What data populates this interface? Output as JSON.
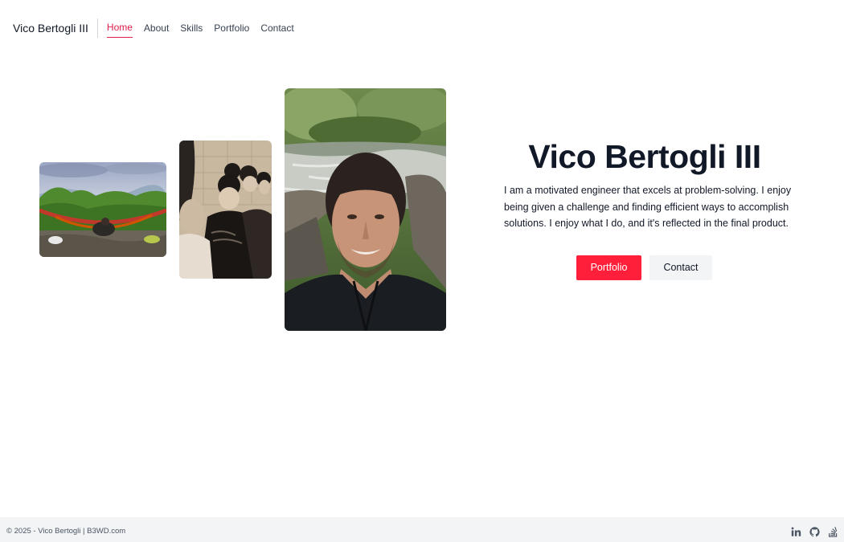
{
  "nav": {
    "brand": "Vico Bertogli III",
    "links": [
      "Home",
      "About",
      "Skills",
      "Portfolio",
      "Contact"
    ],
    "active": "Home"
  },
  "hero": {
    "title": "Vico Bertogli III",
    "description": "I am a motivated engineer that excels at problem-solving. I enjoy being given a challenge and finding efficient ways to accomplish solutions. I enjoy what I do, and it's reflected in the final product.",
    "primary_button": "Portfolio",
    "secondary_button": "Contact"
  },
  "photos": [
    {
      "subject": "hammock-landscape-photo"
    },
    {
      "subject": "childhood-group-photo"
    },
    {
      "subject": "portrait-by-river-photo"
    }
  ],
  "footer": {
    "copyright": "© 2025 - Vico Bertogli | B3WD.com",
    "icons": [
      "linkedin-icon",
      "github-icon",
      "stackoverflow-icon"
    ]
  },
  "colors": {
    "accent": "#ff1f3a",
    "active_link": "#e11d48",
    "footer_bg": "#f3f4f6",
    "heading": "#111827"
  }
}
